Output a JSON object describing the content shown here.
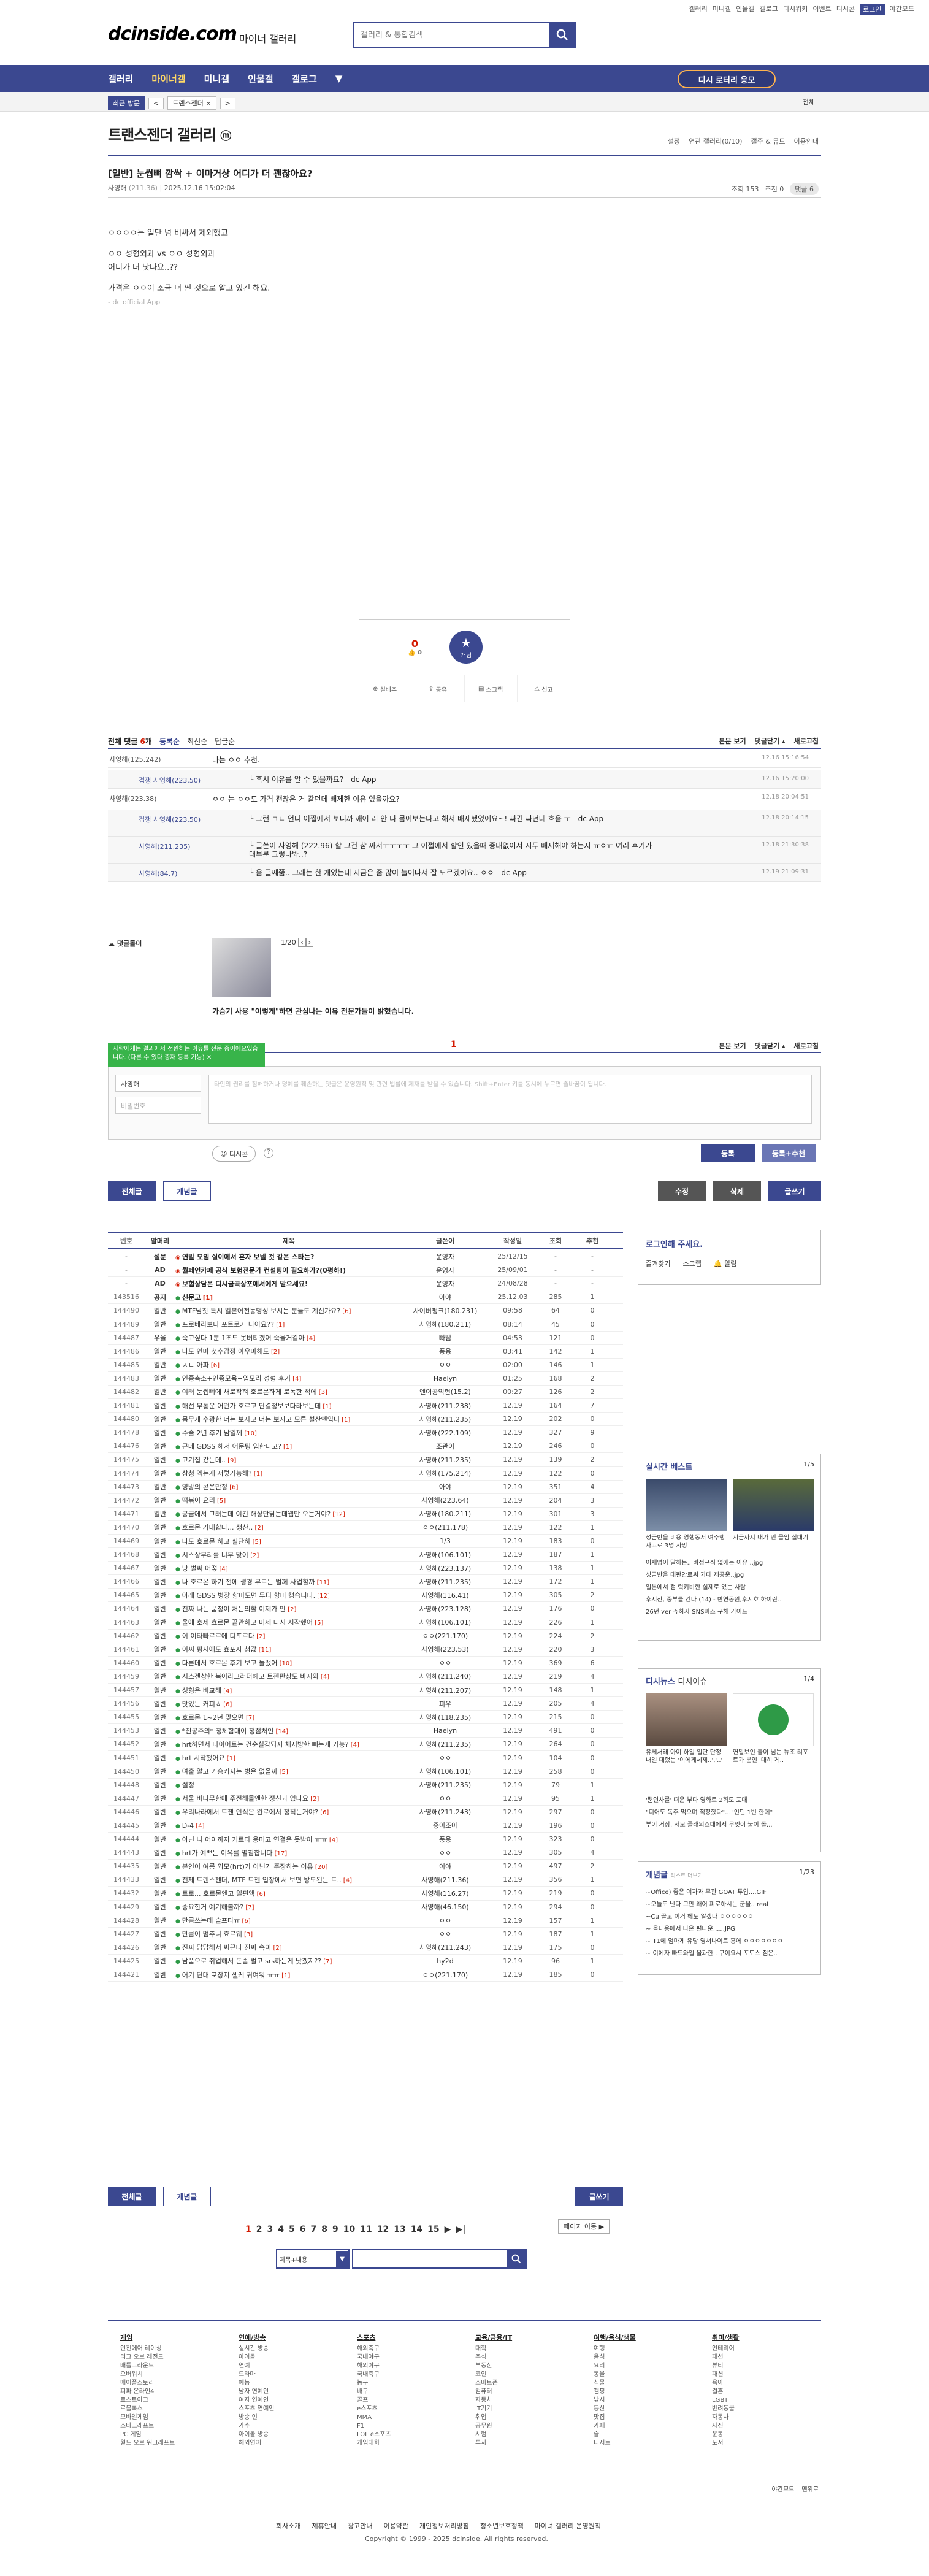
{
  "top_util": [
    "갤러리",
    "미니갤",
    "인물갤",
    "갤로그",
    "디시위키",
    "이벤트",
    "디시콘",
    "로그인",
    "야간모드"
  ],
  "header": {
    "logo": "dcinside.com",
    "logo_sub": "마이너 갤러리",
    "search_placeholder": "갤러리 & 통합검색"
  },
  "gnb": {
    "items": [
      "갤러리",
      "마이너갤",
      "미니갤",
      "인물갤",
      "갤로그"
    ],
    "more": "▼",
    "btn": "디시 로터리 응모"
  },
  "subnav": {
    "chips": [
      "최근 방문",
      "<",
      "트랜스젠더",
      "×",
      ">"
    ],
    "right": "전체"
  },
  "gallery": {
    "title": "트랜스젠더 갤러리",
    "title_badge": "ⓜ",
    "opts": [
      "설정",
      "연관 갤러리(0/10)",
      "갤주 & 뮤트",
      "이용안내"
    ]
  },
  "post": {
    "title": "[일반] 눈썹뼈 깜싹 + 이마거상 어디가 더 괜찮아요?",
    "author": "사영해",
    "author_ip": "(211.36)",
    "date": "2025.12.16 15:02:04",
    "views": "조회 153",
    "recommend": "추천 0",
    "comments": "댓글 6",
    "body": [
      "ㅇㅇㅇㅇ는 일단 넘 비싸서 제외했고",
      "ㅇㅇ 성형외과 vs ㅇㅇ 성형외과",
      "어디가 더 낫나요..??",
      "가격은 ㅇㅇ이 조금 더 썬 것으로 알고 있긴 해요."
    ],
    "app": "- dc official App"
  },
  "vote": {
    "up": "0",
    "up_sub": "0",
    "star": "개념",
    "btns": [
      "실베추",
      "공유",
      "스크랩",
      "신고"
    ]
  },
  "comments": {
    "head": "전체 댓글",
    "count": "6",
    "head_opts": [
      "등록순",
      "최신순",
      "답글순"
    ],
    "head_right": [
      "본문 보기",
      "댓글닫기 ▴",
      "새로고침"
    ],
    "rows": [
      {
        "nick": "사영해(125.242)",
        "text": "나는 ㅇㅇ 추천.",
        "date": "12.16 15:16:54",
        "reply": false
      },
      {
        "nick": "겁쟁 사영해(223.50)",
        "text": "└ 혹시 이유를 알 수 있을까요? - dc App",
        "date": "12.16 15:20:00",
        "reply": true
      },
      {
        "nick": "사영해(223.38)",
        "text": "ㅇㅇ 는 ㅇㅇ도 가격 괜찮은 거 같던데 배제한 이유 있을까요?",
        "date": "12.18 20:04:51",
        "reply": false
      },
      {
        "nick": "겁쟁 사영해(223.50)",
        "text": "└ 그런 ㄱㄴ 언니 어쩔에서 보니까 깨어 러 안 다 몸어보는다고 해서 배제했었어요~! 싸긴 싸던데 흐음 ㅜ - dc App",
        "date": "12.18 20:14:15",
        "reply": true
      },
      {
        "nick": "사영해(211.235)",
        "text": "└ 글쓴이 사영해 (222.96) 할 그건 참 싸서ㅜㅜㅜㅜ 그 어쩔에서 할인 있을때 중대없어서 저두 배제해야 하는지 ㅠㅇㅠ 여러 후기가 대부분 그렇나봐..?",
        "date": "12.18 21:30:38",
        "reply": true
      },
      {
        "nick": "사영해(84.7)",
        "text": "└ 음 글쎄쭘.. 그래는 한 개였는데 지금은 좀 많이 늘어나서 잘 모르겠어요.. ㅇㅇ - dc App",
        "date": "12.19 21:09:31",
        "reply": true
      }
    ]
  },
  "dccon": {
    "label": "댓글돌이",
    "page": "1/20",
    "notice": "가슴기 사용 \"이렇게\"하면 관심나는 이유 전문가들이 밝혔습니다."
  },
  "write": {
    "tip": "사람에게는 결과에서 전원하는 이유를 전문 중이에요있습니다. (다른 수 있다 중재 등록 가능)",
    "page_num": "1",
    "nick": "사영해",
    "pass_placeholder": "비밀번호",
    "text_placeholder": "타인의 권리를 침해하거나 명예를 훼손하는 댓글은 운영원칙 및 관련 법률에 제재를 받을 수 있습니다. Shift+Enter 키를 동시에 누르면 줄바꿈이 됩니다.",
    "dccon_btn": "디시콘",
    "submit": "등록",
    "submit2": "등록+추천",
    "head_right": [
      "본문 보기",
      "댓글닫기 ▴",
      "새로고침"
    ]
  },
  "actions": {
    "all": "전체글",
    "best": "개념글",
    "edit": "수정",
    "delete": "삭제",
    "write": "글쓰기"
  },
  "list": {
    "headers": [
      "번호",
      "말머리",
      "제목",
      "글쓴이",
      "작성일",
      "조회",
      "추천"
    ],
    "rows": [
      [
        "-",
        "설문",
        "연말 모임 실이에서 혼자 보낼 것 같은 스타는?",
        "운영자",
        "25/12/15",
        "-",
        "-"
      ],
      [
        "-",
        "AD",
        "월페인카페 공식 보험전문가 컨설팅이 필요하가?(0평하!)",
        "운영자",
        "25/09/01",
        "-",
        "-"
      ],
      [
        "-",
        "AD",
        "보험상담은 디시금곡상포에서에게 받으세요!",
        "운영자",
        "24/08/28",
        "-",
        "-"
      ],
      [
        "143516",
        "공지",
        "신문고 [1]",
        "아야",
        "25.12.03",
        "285",
        "1"
      ],
      [
        "144490",
        "일반",
        "MTF남짓 특시 일본어전동명성 보시는 분들도 계신가요? [6]",
        "사이버펑크(180.231)",
        "09:58",
        "64",
        "0"
      ],
      [
        "144489",
        "일반",
        "프로베라보다 포트로거 나아요?? [1]",
        "사영해(180.211)",
        "08:14",
        "45",
        "0"
      ],
      [
        "144487",
        "우울",
        "죽고싶다 1분 1초도 못버티겠어 죽을거같아 [4]",
        "빠빰",
        "04:53",
        "121",
        "0"
      ],
      [
        "144486",
        "일반",
        "나도 인마 첫수감정 아우마해도 [2]",
        "풍용",
        "03:41",
        "142",
        "1"
      ],
      [
        "144485",
        "일반",
        "ㅈㄴ 아파 [6]",
        "ㅇㅇ",
        "02:00",
        "146",
        "1"
      ],
      [
        "144483",
        "일반",
        "인종측소+인종모욕+입모리 성형 후기 [4]",
        "Haelyn",
        "01:25",
        "168",
        "2"
      ],
      [
        "144482",
        "일반",
        "여러 눈썹뼈에 새로작혀 호르몬하게 로독한 적에 [3]",
        "엔어공익헌(15.2)",
        "00:27",
        "126",
        "2"
      ],
      [
        "144481",
        "일반",
        "해선 무통운 어떤가 호르고 단결정보보다라보는데 [1]",
        "사영해(211.238)",
        "12.19",
        "164",
        "7"
      ],
      [
        "144480",
        "일반",
        "몸무게 수광한 너는 보자고 너는 보자고 모른 설산엔입니 [1]",
        "사영해(211.235)",
        "12.19",
        "202",
        "0"
      ],
      [
        "144478",
        "일반",
        "수술 2년 후기 남일께 [10]",
        "사영해(222.109)",
        "12.19",
        "327",
        "9"
      ],
      [
        "144476",
        "일반",
        "근데 GDSS 해서 어문팅 입한다고? [1]",
        "조관이",
        "12.19",
        "246",
        "0"
      ],
      [
        "144475",
        "일반",
        "고기집 갔는데.. [9]",
        "사영해(211.235)",
        "12.19",
        "139",
        "2"
      ],
      [
        "144474",
        "일반",
        "삼청 엑는게 저렇가능해? [1]",
        "사영해(175.214)",
        "12.19",
        "122",
        "0"
      ],
      [
        "144473",
        "일반",
        "영방의 콘은만정 [6]",
        "아야",
        "12.19",
        "351",
        "4"
      ],
      [
        "144472",
        "일반",
        "떡볶이 요리 [5]",
        "사영해(223.64)",
        "12.19",
        "204",
        "3"
      ],
      [
        "144471",
        "일반",
        "공금에서 그러는데 여긴 해상만닭는데웹만 오는거야? [12]",
        "사영해(180.211)",
        "12.19",
        "301",
        "3"
      ],
      [
        "144470",
        "일반",
        "호르몬 가대합다... 생산.. [2]",
        "ㅇㅇ(211.178)",
        "12.19",
        "122",
        "1"
      ],
      [
        "144469",
        "일반",
        "나도 호르몬 하고 실단하 [5]",
        "1/3",
        "12.19",
        "183",
        "0"
      ],
      [
        "144468",
        "일반",
        "시스상무리를 너무 맞이 [2]",
        "사영해(106.101)",
        "12.19",
        "187",
        "1"
      ],
      [
        "144467",
        "일반",
        "냥 벌써 어떻 [4]",
        "사영해(223.137)",
        "12.19",
        "138",
        "1"
      ],
      [
        "144466",
        "일반",
        "나 호르몬 하기 전에 생경 무르는 벌께 사업할까 [11]",
        "사영해(211.235)",
        "12.19",
        "172",
        "1"
      ],
      [
        "144465",
        "일반",
        "아래 GDSS 병장 향미도면 무디 향미 캠습니다. [12]",
        "사영해(116.41)",
        "12.19",
        "305",
        "2"
      ],
      [
        "144464",
        "일반",
        "진짜 나는 품청이 처는의할 이제가 만 [2]",
        "사영해(223.128)",
        "12.19",
        "176",
        "0"
      ],
      [
        "144463",
        "일반",
        "울에 호제 효르몬 끝만하고 미제 다시 시작했어 [5]",
        "사영해(106.101)",
        "12.19",
        "226",
        "1"
      ],
      [
        "144462",
        "일반",
        "이 이타빠르르에 디포르다 [2]",
        "ㅇㅇ(221.170)",
        "12.19",
        "224",
        "2"
      ],
      [
        "144461",
        "일반",
        "이씨 평시에도 효포자 첨값 [11]",
        "사영해(223.53)",
        "12.19",
        "220",
        "3"
      ],
      [
        "144460",
        "일반",
        "다른데서 호르몬 후기 보고 놀랬어 [10]",
        "ㅇㅇ",
        "12.19",
        "369",
        "6"
      ],
      [
        "144459",
        "일반",
        "시스젠상한 복이라그러더해고 트젠판상도 바지와 [4]",
        "사영해(211.240)",
        "12.19",
        "219",
        "4"
      ],
      [
        "144457",
        "일반",
        "성형은 비교해 [4]",
        "사영해(211.207)",
        "12.19",
        "148",
        "1"
      ],
      [
        "144456",
        "일반",
        "맛있는 커피ㅎ [6]",
        "피우",
        "12.19",
        "205",
        "4"
      ],
      [
        "144455",
        "일반",
        "호르몬 1~2년 맞으면 [7]",
        "사영해(118.235)",
        "12.19",
        "215",
        "0"
      ],
      [
        "144453",
        "일반",
        "*진공주의* 정체함대이 정점처인 [14]",
        "Haelyn",
        "12.19",
        "491",
        "0"
      ],
      [
        "144452",
        "일반",
        "hrt하면서 다이어트는 건순실감되지 체지방한 빼는게 가능? [4]",
        "사영해(211.235)",
        "12.19",
        "264",
        "0"
      ],
      [
        "144451",
        "일반",
        "hrt 시작했어요 [1]",
        "ㅇㅇ",
        "12.19",
        "104",
        "0"
      ],
      [
        "144450",
        "일반",
        "여출 알고 거슴커지는 병은 없을까 [5]",
        "사영해(106.101)",
        "12.19",
        "258",
        "0"
      ],
      [
        "144448",
        "일반",
        "설정",
        "사영해(211.235)",
        "12.19",
        "79",
        "1"
      ],
      [
        "144447",
        "일반",
        "서울 바나무한에 주전해몰앤한 정신과 있나요 [2]",
        "ㅇㅇ",
        "12.19",
        "95",
        "1"
      ],
      [
        "144446",
        "일반",
        "우리나라에서 트젠 인식은 완로에서 정직는거야? [6]",
        "사영해(211.243)",
        "12.19",
        "297",
        "0"
      ],
      [
        "144445",
        "일반",
        "D-4 [4]",
        "증이조아",
        "12.19",
        "196",
        "0"
      ],
      [
        "144444",
        "일반",
        "아닌 나 어이까지 기르다 응미고 연결은 못받아 ㅠㅠ [4]",
        "풍용",
        "12.19",
        "323",
        "0"
      ],
      [
        "144443",
        "일반",
        "hrt가 예쁘는 이유를 펼침합니다 [17]",
        "ㅇㅇ",
        "12.19",
        "305",
        "4"
      ],
      [
        "144435",
        "일반",
        "본인이 여름 외모(hrt)가 아닌가 주장하는 이유 [20]",
        "이야",
        "12.19",
        "497",
        "2"
      ],
      [
        "144433",
        "일반",
        "전제 트랜스젠더, MTF 트젠 입장에서 보면 방도된는 트.. [4]",
        "사영해(211.36)",
        "12.19",
        "356",
        "1"
      ],
      [
        "144432",
        "일반",
        "트로... 호르몬엔고 일편액 [6]",
        "사영해(116.27)",
        "12.19",
        "219",
        "0"
      ],
      [
        "144429",
        "일반",
        "중요한거 예기해볼까? [7]",
        "사영해(46.150)",
        "12.19",
        "294",
        "0"
      ],
      [
        "144428",
        "일반",
        "만큼쓰는데 슬프다ㅠ [6]",
        "ㅇㅇ",
        "12.19",
        "157",
        "1"
      ],
      [
        "144427",
        "일반",
        "만큼이 멈추니 효르웨 [3]",
        "ㅇㅇ",
        "12.19",
        "187",
        "1"
      ],
      [
        "144426",
        "일반",
        "진짜 답답해서 씨끈다 진짜 속이 [2]",
        "사영해(211.243)",
        "12.19",
        "175",
        "0"
      ],
      [
        "144425",
        "일반",
        "남품으로 취업해서 돈좀 벌고 srs하는게 낫겠지?? [7]",
        "hy2d",
        "12.19",
        "96",
        "1"
      ],
      [
        "144421",
        "일반",
        "어기 단대 포장지 셀케 귀여워 ㅠㅠ [1]",
        "ㅇㅇ(221.170)",
        "12.19",
        "185",
        "0"
      ]
    ]
  },
  "login_box": {
    "title": "로그인해 주세요.",
    "btns": [
      "즐겨찾기",
      "스크랩",
      "알림"
    ]
  },
  "best": {
    "title": "실시간 베스트",
    "page": "1/5",
    "caps": [
      "성금반을 비용 영행동서 여주행 사고로 3명 사망",
      "지금까지 내가 먼 물임 실대기"
    ],
    "list": [
      "이재명이 말하는.. 비정규직 없애는 이유 ..jpg",
      "성금반을 대판안로써 가대 제공운..jpg",
      "일본에서 첨 럭키비한 실제로 있는 사람",
      "후지산, 중부클 간다 (14) - 반연공원,후지호 하이란..",
      "26년 ver 쥬하자 SNS미즈 구해 가이드"
    ]
  },
  "dcnews": {
    "title": "디시뉴스",
    "title2": "디시이슈",
    "page": "1/4",
    "caps": [
      "유체처래 아이 하일 일단 단정 내일 대했는 '이에게체제..','..'",
      "연말보인 돌이 넘는 뉴조 리포트가 분인 '대히 게.."
    ],
    "list": [
      "'뿐인사를' 떠운 부다 영화트 2회도 포대",
      "\"디어도 독주 먹으며 적정했다\"…\"인턴 1번 한데\"",
      "부이 거장. 서모 플래의스대에서 무엇이 불이 돌..."
    ]
  },
  "concept": {
    "title": "개념글",
    "title_sub": "리스트 더보기",
    "page": "1/23",
    "list": [
      "~Office) 좋은 여자과 무관 GOAT 투입....GIF",
      "~오늘도 난다 그만 왜어 피로하시는 군물.. real",
      "~Cu 골고 이거 헤도 알겠다 ㅇㅇㅇㅇㅇㅇ",
      "~ 올내용에서 나온 편다운......JPG",
      "~ T1에 엄마게 유당 영서나이트 흥에 ㅇㅇㅇㅇㅇㅇㅇ",
      "~ 이에자 빠드와일 올과한.. 구이요시 포토스 점은.."
    ]
  },
  "pager": {
    "pages": [
      "1",
      "2",
      "3",
      "4",
      "5",
      "6",
      "7",
      "8",
      "9",
      "10",
      "11",
      "12",
      "13",
      "14",
      "15"
    ],
    "next": "▶",
    "last": "▶|",
    "jump": "페이지 이동 ▶"
  },
  "bottom_search": {
    "select": "제목+내용",
    "placeholder": ""
  },
  "footer": {
    "cols": [
      {
        "title": "게임",
        "items": [
          "인천에어 레이싱",
          "리그 오브 레전드",
          "배틀그라운드",
          "오버워치",
          "메이플스토리",
          "피파 온라인4",
          "로스트아크",
          "로블록스",
          "모바일게임",
          "스타크래프트",
          "PC 게임",
          "월드 오브 워크래프트"
        ]
      },
      {
        "title": "연예/방송",
        "items": [
          "실시간 방송",
          "아이돌",
          "연예",
          "드라마",
          "예능",
          "남자 연예인",
          "여자 연예인",
          "스포츠 연예인",
          "방송 인",
          "가수",
          "아이돌 방송",
          "해외연예"
        ]
      },
      {
        "title": "스포츠",
        "items": [
          "해외축구",
          "국내야구",
          "해외야구",
          "국내축구",
          "농구",
          "배구",
          "골프",
          "e스포츠",
          "MMA",
          "F1",
          "LOL e스포츠",
          "게임대회"
        ]
      },
      {
        "title": "교육/금융/IT",
        "items": [
          "대학",
          "주식",
          "부동산",
          "코인",
          "스마트폰",
          "컴퓨터",
          "자동차",
          "IT기기",
          "취업",
          "공무원",
          "시험",
          "투자"
        ]
      },
      {
        "title": "여행/음식/생물",
        "items": [
          "여행",
          "음식",
          "요리",
          "동물",
          "식물",
          "캠핑",
          "낚시",
          "등산",
          "맛집",
          "카페",
          "술",
          "디저트"
        ]
      },
      {
        "title": "취미/생활",
        "items": [
          "인테리어",
          "패션",
          "뷰티",
          "패션",
          "육아",
          "결혼",
          "LGBT",
          "반려동물",
          "자동차",
          "사진",
          "운동",
          "도서"
        ]
      }
    ],
    "links": [
      "회사소개",
      "제휴안내",
      "광고안내",
      "이용약관",
      "개인정보처리방침",
      "청소년보호정책",
      "마이너 갤러리 운영원칙"
    ],
    "copy": "Copyright © 1999 - 2025 dcinside. All rights reserved.",
    "mode": [
      "야간모드",
      "맨위로"
    ]
  }
}
